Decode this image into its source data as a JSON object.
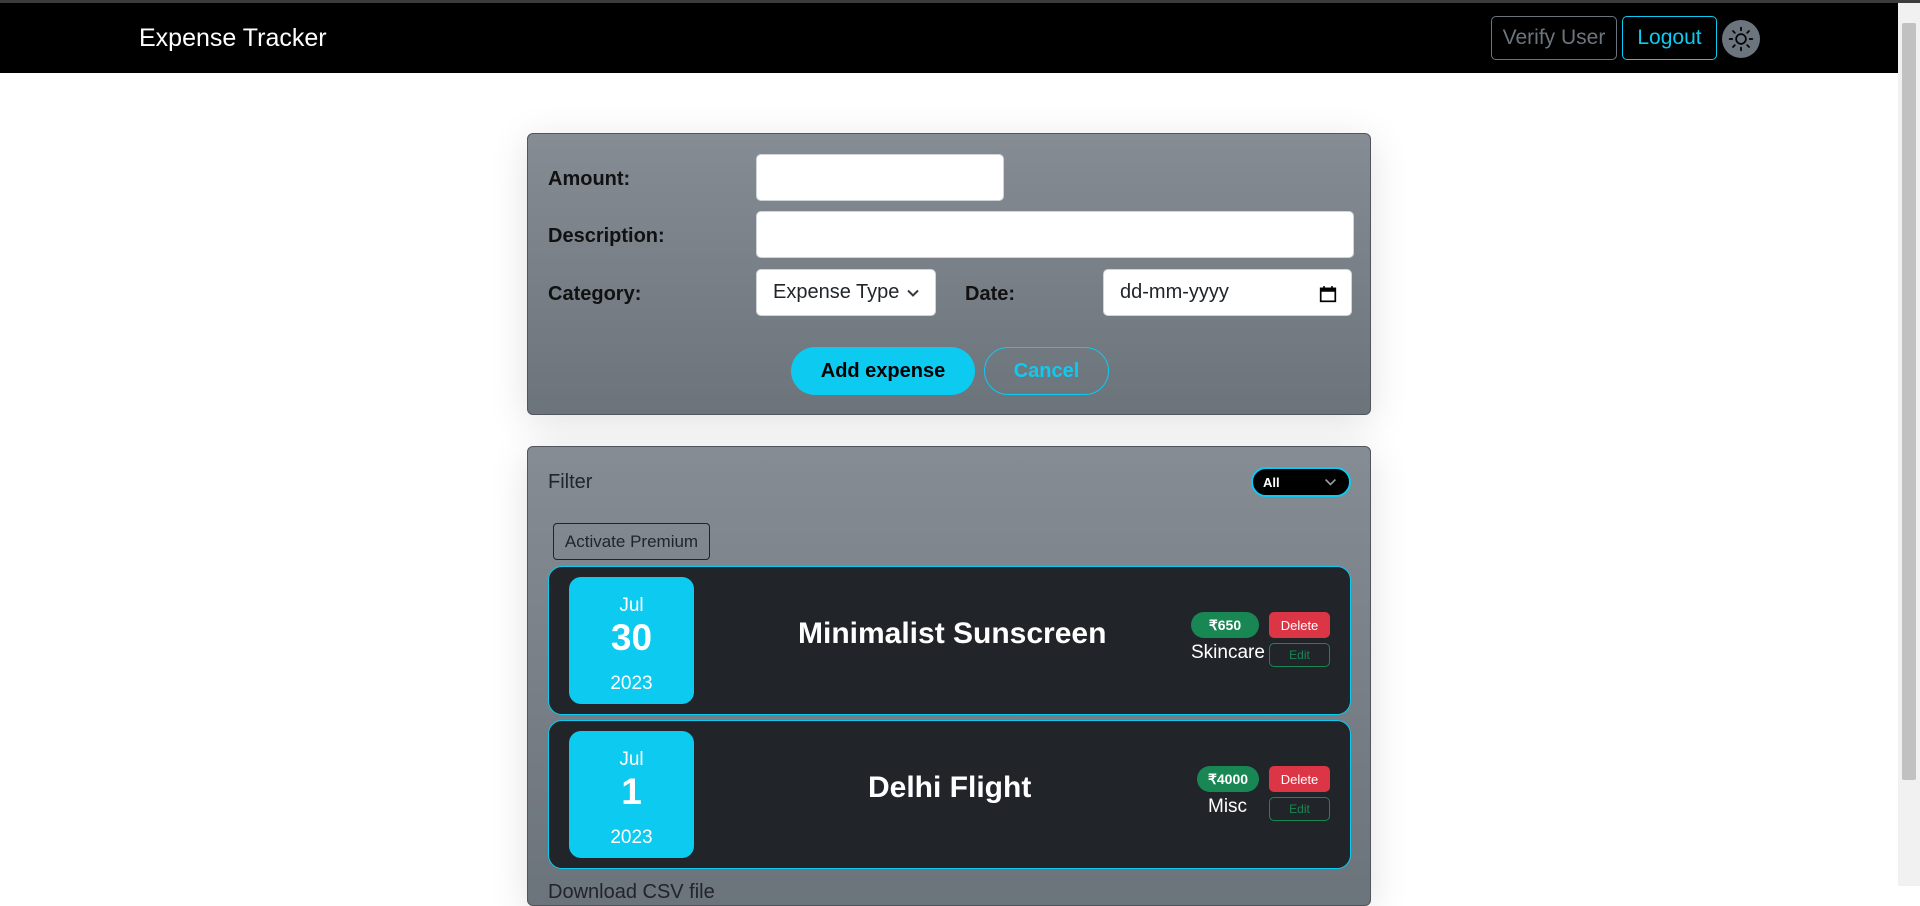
{
  "navbar": {
    "brand": "Expense Tracker",
    "verify_label": "Verify User",
    "logout_label": "Logout",
    "theme_icon": "sun-icon"
  },
  "form": {
    "amount_label": "Amount:",
    "amount_value": "",
    "description_label": "Description:",
    "description_value": "",
    "category_label": "Category:",
    "category_selected": "Expense Type",
    "date_label": "Date:",
    "date_placeholder": "dd-mm-yyyy",
    "add_label": "Add expense",
    "cancel_label": "Cancel"
  },
  "list": {
    "filter_label": "Filter",
    "filter_selected": "All",
    "premium_label": "Activate Premium",
    "expenses": [
      {
        "month": "Jul",
        "day": "30",
        "year": "2023",
        "title": "Minimalist Sunscreen",
        "amount": "₹650",
        "category": "Skincare",
        "delete_label": "Delete",
        "edit_label": "Edit"
      },
      {
        "month": "Jul",
        "day": "1",
        "year": "2023",
        "title": "Delhi Flight",
        "amount": "₹4000",
        "category": "Misc",
        "delete_label": "Delete",
        "edit_label": "Edit"
      }
    ],
    "download_label": "Download CSV file"
  },
  "colors": {
    "accent": "#0dcaf0",
    "success": "#198754",
    "danger": "#dc3545",
    "navbar": "#000000"
  }
}
